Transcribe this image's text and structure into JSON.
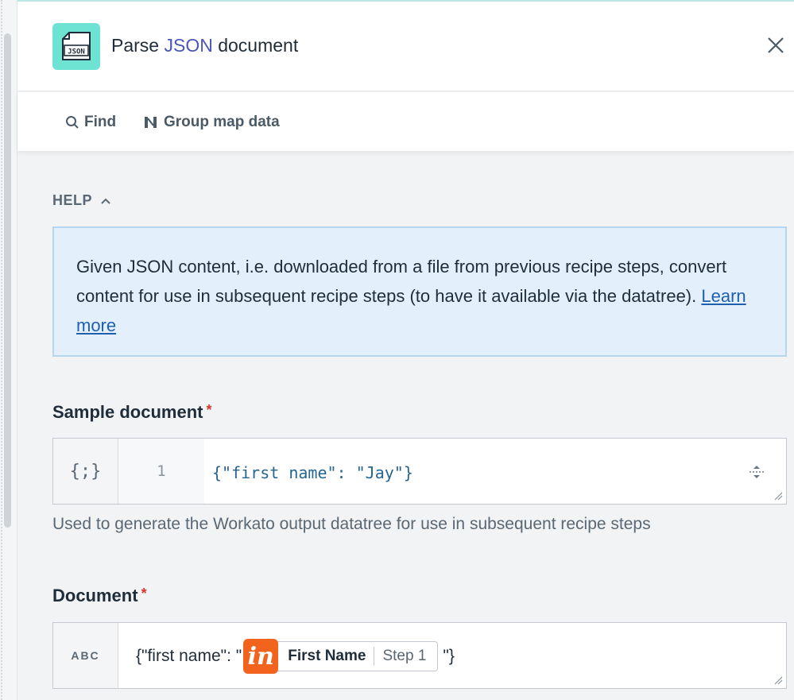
{
  "header": {
    "title_prefix": "Parse ",
    "title_accent": "JSON",
    "title_suffix": " document",
    "app_icon_label": "JSON",
    "icon": "json-document-icon",
    "close_icon": "close-icon"
  },
  "toolbar": {
    "find_label": "Find",
    "group_label": "Group map data"
  },
  "help": {
    "toggle_label": "HELP",
    "text": "Given JSON content, i.e. downloaded from a file from previous recipe steps, convert content for use in subsequent recipe steps (to have it available via the datatree). ",
    "link_label": "Learn more"
  },
  "sample_document": {
    "label": "Sample document",
    "required_mark": "*",
    "type_label": "{;}",
    "line_number": "1",
    "value": "{\"first name\": \"Jay\"}",
    "hint": "Used to generate the Workato output datatree for use in subsequent recipe steps"
  },
  "document": {
    "label": "Document",
    "required_mark": "*",
    "type_label": "ABC",
    "prefix": "{\"first name\": \"",
    "pill_icon_text": "in",
    "pill_name": "First Name",
    "pill_step": "Step 1",
    "suffix": "\"}"
  },
  "colors": {
    "accent": "#4a56b8",
    "app_icon_bg": "#6ee2d3",
    "help_bg": "#e3f0fb",
    "pill_icon_bg": "#f2641e",
    "required": "#d9362f"
  }
}
